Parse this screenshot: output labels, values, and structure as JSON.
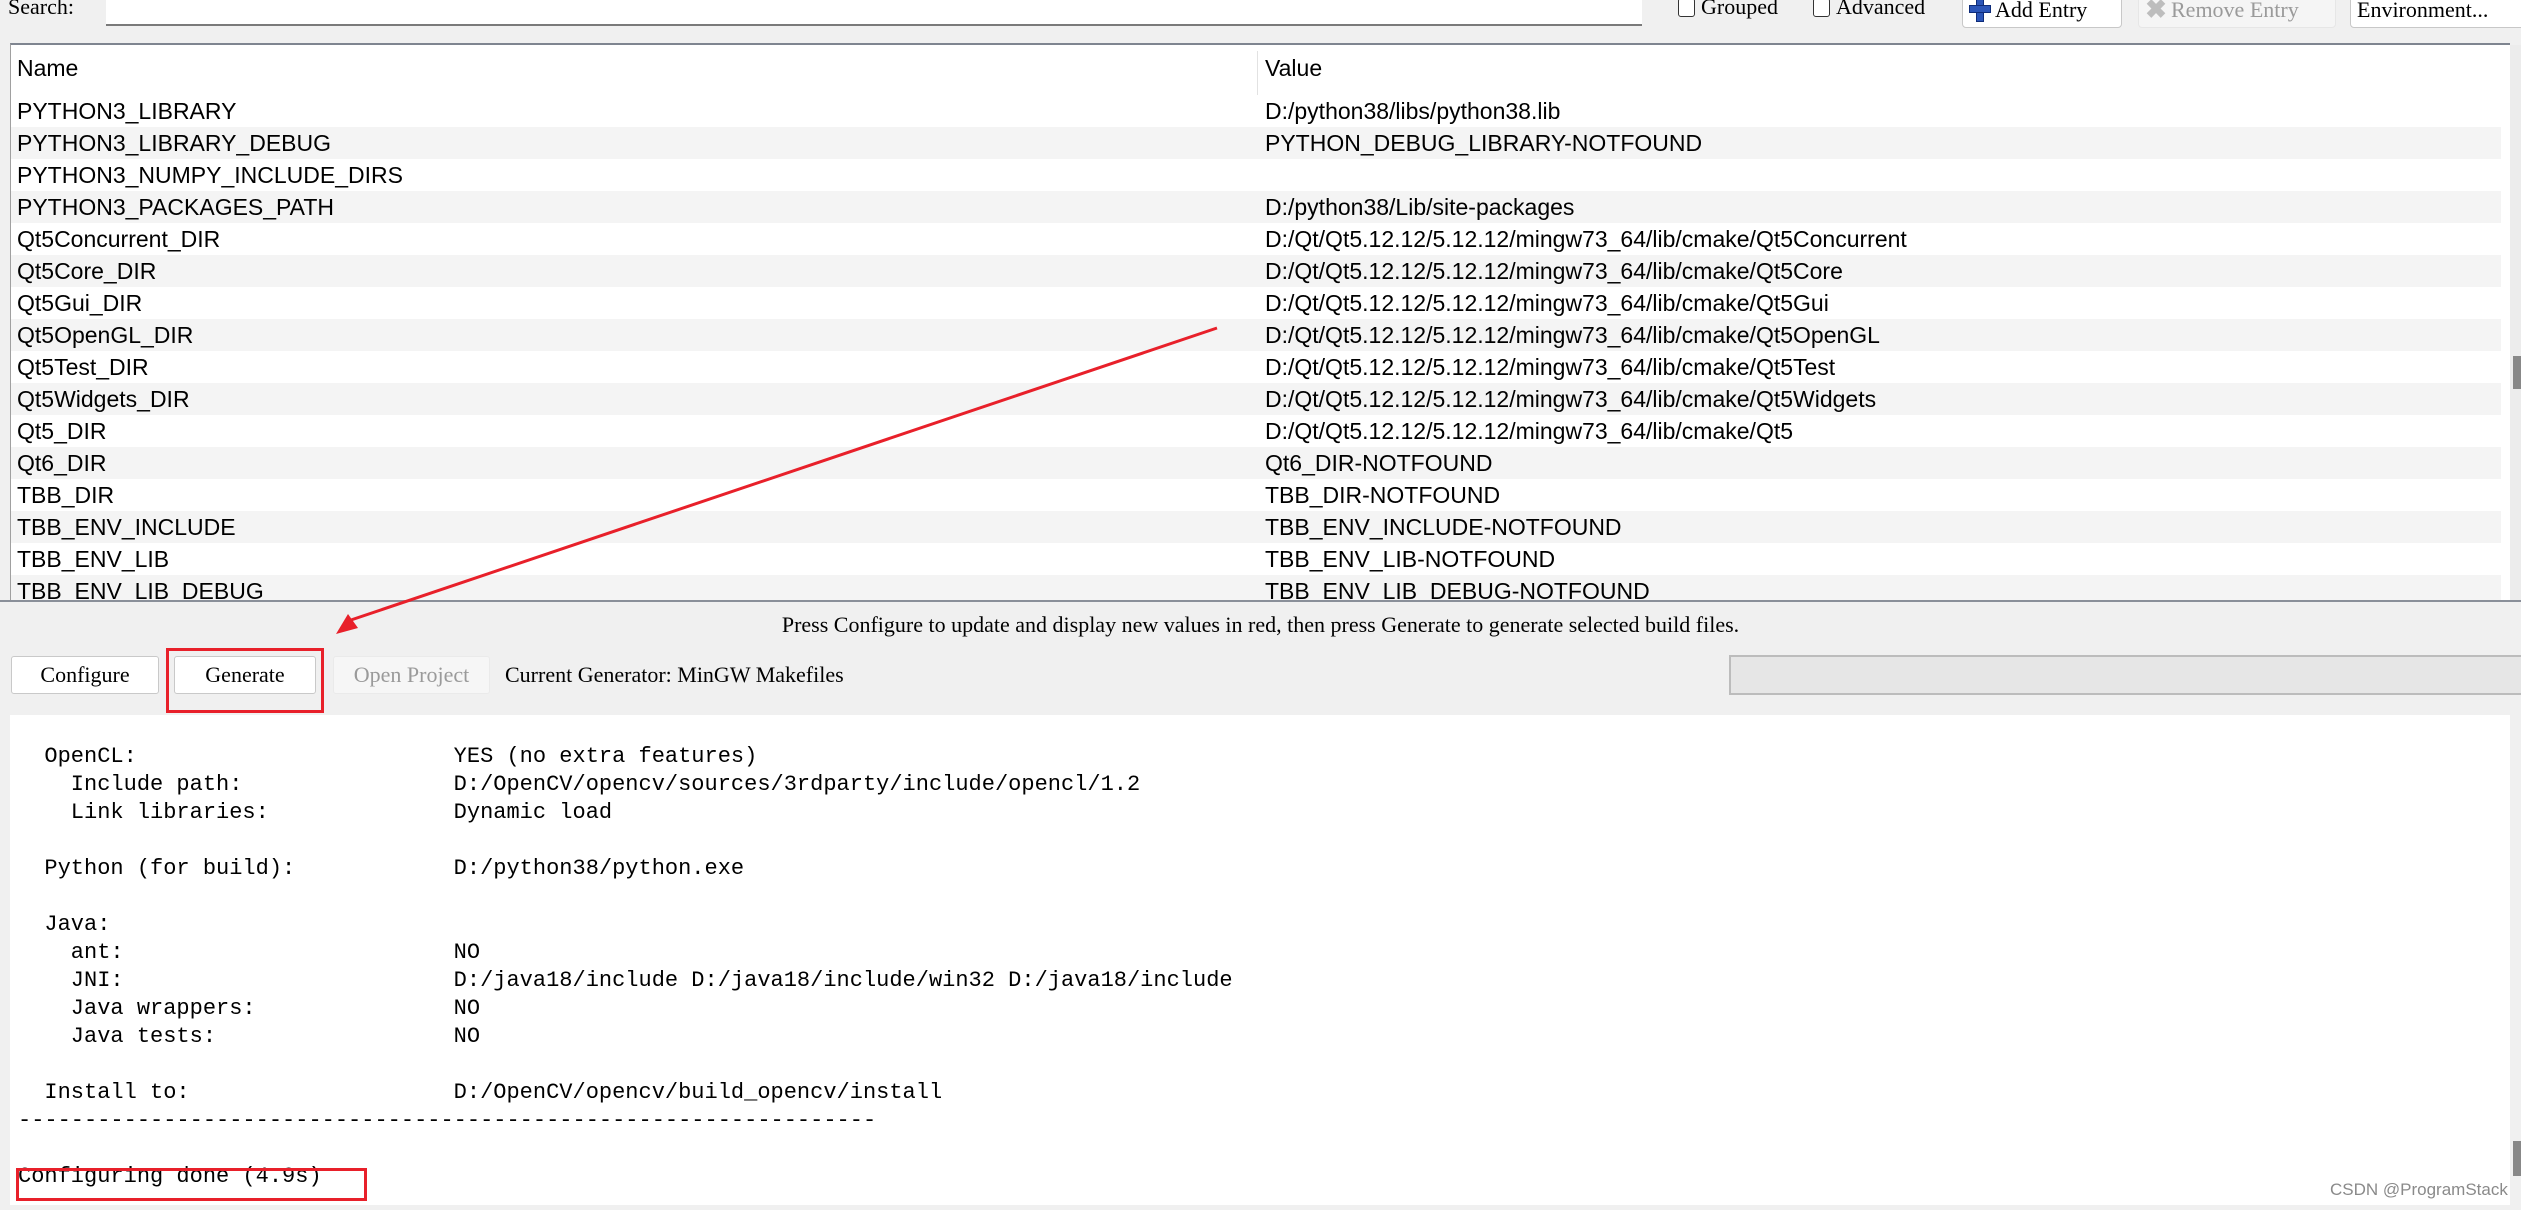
{
  "toolbar": {
    "search_label": "Search:",
    "search_value": "",
    "grouped_label": "Grouped",
    "grouped_checked": false,
    "advanced_label": "Advanced",
    "advanced_checked": false,
    "add_entry_label": "Add Entry",
    "remove_entry_label": "Remove Entry",
    "environment_label": "Environment..."
  },
  "table": {
    "columns": [
      "Name",
      "Value"
    ],
    "rows": [
      {
        "name": "PYTHON3_LIBRARY",
        "value": "D:/python38/libs/python38.lib"
      },
      {
        "name": "PYTHON3_LIBRARY_DEBUG",
        "value": "PYTHON_DEBUG_LIBRARY-NOTFOUND"
      },
      {
        "name": "PYTHON3_NUMPY_INCLUDE_DIRS",
        "value": ""
      },
      {
        "name": "PYTHON3_PACKAGES_PATH",
        "value": "D:/python38/Lib/site-packages"
      },
      {
        "name": "Qt5Concurrent_DIR",
        "value": "D:/Qt/Qt5.12.12/5.12.12/mingw73_64/lib/cmake/Qt5Concurrent"
      },
      {
        "name": "Qt5Core_DIR",
        "value": "D:/Qt/Qt5.12.12/5.12.12/mingw73_64/lib/cmake/Qt5Core"
      },
      {
        "name": "Qt5Gui_DIR",
        "value": "D:/Qt/Qt5.12.12/5.12.12/mingw73_64/lib/cmake/Qt5Gui"
      },
      {
        "name": "Qt5OpenGL_DIR",
        "value": "D:/Qt/Qt5.12.12/5.12.12/mingw73_64/lib/cmake/Qt5OpenGL"
      },
      {
        "name": "Qt5Test_DIR",
        "value": "D:/Qt/Qt5.12.12/5.12.12/mingw73_64/lib/cmake/Qt5Test"
      },
      {
        "name": "Qt5Widgets_DIR",
        "value": "D:/Qt/Qt5.12.12/5.12.12/mingw73_64/lib/cmake/Qt5Widgets"
      },
      {
        "name": "Qt5_DIR",
        "value": "D:/Qt/Qt5.12.12/5.12.12/mingw73_64/lib/cmake/Qt5"
      },
      {
        "name": "Qt6_DIR",
        "value": "Qt6_DIR-NOTFOUND"
      },
      {
        "name": "TBB_DIR",
        "value": "TBB_DIR-NOTFOUND"
      },
      {
        "name": "TBB_ENV_INCLUDE",
        "value": "TBB_ENV_INCLUDE-NOTFOUND"
      },
      {
        "name": "TBB_ENV_LIB",
        "value": "TBB_ENV_LIB-NOTFOUND"
      },
      {
        "name": "TBB_ENV_LIB_DEBUG",
        "value": "TBB_ENV_LIB_DEBUG-NOTFOUND"
      }
    ]
  },
  "message": "Press Configure to update and display new values in red, then press Generate to generate selected build files.",
  "actions": {
    "configure_label": "Configure",
    "generate_label": "Generate",
    "open_project_label": "Open Project",
    "current_generator": "Current Generator: MinGW Makefiles"
  },
  "progress": 0,
  "output": {
    "lines": [
      "  OpenCL:                        YES (no extra features)",
      "    Include path:                D:/OpenCV/opencv/sources/3rdparty/include/opencl/1.2",
      "    Link libraries:              Dynamic load",
      "",
      "  Python (for build):            D:/python38/python.exe",
      "",
      "  Java:",
      "    ant:                         NO",
      "    JNI:                         D:/java18/include D:/java18/include/win32 D:/java18/include",
      "    Java wrappers:               NO",
      "    Java tests:                  NO",
      "",
      "  Install to:                    D:/OpenCV/opencv/build_opencv/install",
      "-----------------------------------------------------------------",
      "",
      "Configuring done (4.9s)"
    ]
  },
  "annotations": {
    "color": "#e8202a"
  },
  "watermark": "CSDN @ProgramStack"
}
